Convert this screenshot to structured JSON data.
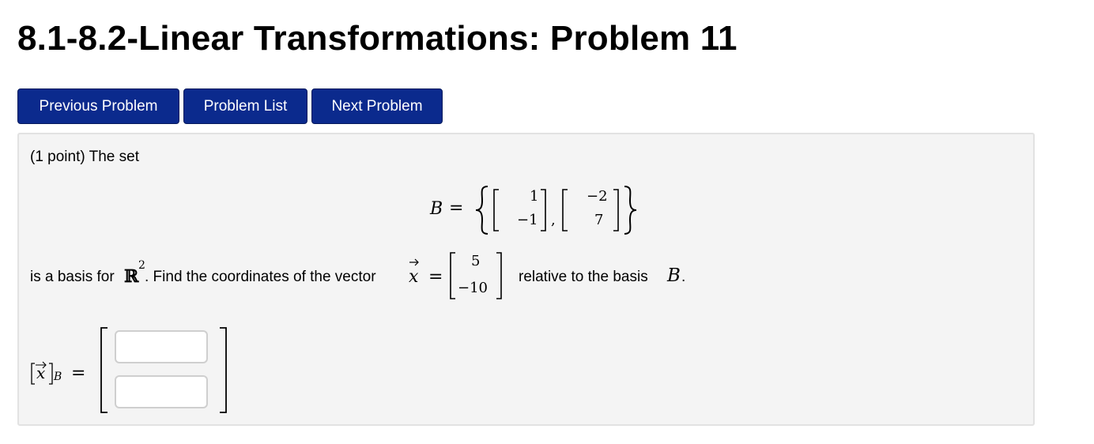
{
  "page": {
    "title": "8.1-8.2-Linear Transformations: Problem 11"
  },
  "nav": {
    "previous_label": "Previous Problem",
    "list_label": "Problem List",
    "next_label": "Next Problem"
  },
  "problem": {
    "intro": "(1 point) The set",
    "basis_symbol": "B",
    "equals": "=",
    "basis_vectors": [
      {
        "top": "1",
        "bottom": "−1"
      },
      {
        "top": "−2",
        "bottom": "7"
      }
    ],
    "basis_comma": ",",
    "sentence_part1": "is a basis for",
    "field_symbol": "ℝ",
    "field_exponent": "2",
    "sentence_part2": ". Find the coordinates of the vector",
    "vector_symbol": "x",
    "vector_top": "5",
    "vector_bottom": "−10",
    "sentence_part3": "relative to the basis",
    "sentence_basis": "B",
    "sentence_end": ".",
    "answer_label_var": "x",
    "answer_label_sub": "B",
    "answer_inputs": [
      "",
      ""
    ]
  },
  "colors": {
    "button_bg": "#0b2a8d",
    "panel_bg": "#f4f4f4"
  }
}
